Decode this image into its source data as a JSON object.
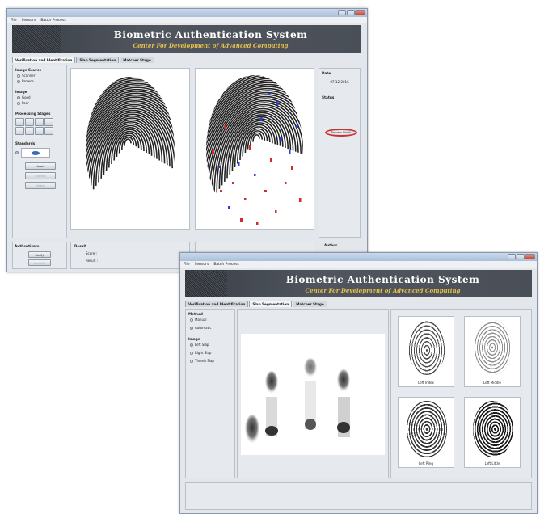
{
  "app": {
    "menu": [
      "File",
      "Sensors",
      "Batch Process"
    ],
    "banner_title": "Biometric Authentication System",
    "banner_subtitle": "Center For Development of Advanced Computing"
  },
  "win1": {
    "tabs": [
      "Verification and Identification",
      "Slap Segmentation",
      "Matcher Stage"
    ],
    "image_source": {
      "label": "Image Source",
      "options": [
        "Scanner",
        "Browse"
      ],
      "selected": "Browse"
    },
    "image": {
      "label": "Image",
      "options": [
        "Good",
        "Poor"
      ],
      "selected": "Good"
    },
    "processing_stages_label": "Processing Stages",
    "standards_label": "Standards",
    "buttons": [
      "Load",
      "Extract",
      "Match"
    ],
    "date": {
      "label": "Date",
      "value": "07-12-2016"
    },
    "status_label": "Status",
    "status_button": "Process Finish",
    "authenticate": {
      "label": "Authenticate",
      "verify": "Verify",
      "identify": "Identify"
    },
    "result": {
      "label": "Result",
      "score_label": "Score :",
      "result_label": "Result :"
    },
    "extra_label": "Author"
  },
  "win2": {
    "tabs": [
      "Verification and Identification",
      "Slap Segmentation",
      "Matcher Stage"
    ],
    "method": {
      "label": "Method",
      "options": [
        "Manual",
        "Automatic"
      ],
      "selected": "Automatic"
    },
    "image": {
      "label": "Image",
      "options": [
        "Left Slap",
        "Right Slap",
        "Thumb Slap"
      ],
      "selected": "Left Slap"
    },
    "thumbs": [
      "Left Index",
      "Left Middle",
      "Left Ring",
      "Left Little"
    ]
  },
  "colors": {
    "minutiae_red": "#d42a2a",
    "minutiae_blue": "#2a3fd4",
    "status_ring": "#c83232"
  }
}
